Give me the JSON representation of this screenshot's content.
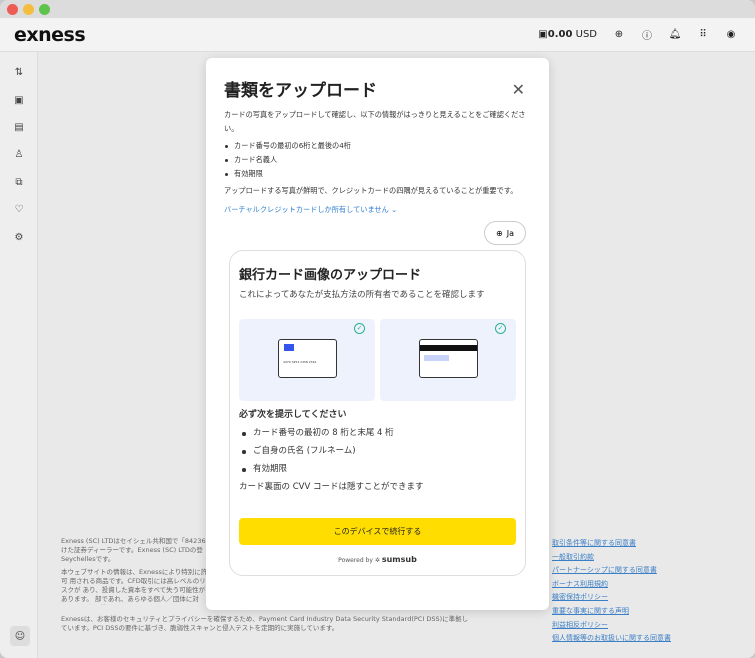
{
  "header": {
    "logo": "exness",
    "balance": "0.00",
    "currency": "USD"
  },
  "modal": {
    "title": "書類をアップロード",
    "intro": "カードの写真をアップロードして確認し、以下の情報がはっきりと見えることをご確認ください。",
    "items": [
      "カード番号の最初の6桁と最後の4桁",
      "カード名義人",
      "有効期限"
    ],
    "note": "アップロードする写真が鮮明で、クレジットカードの四隅が見えるていることが重要です。",
    "virtual_link": "バーチャルクレジットカードしか所有していません",
    "lang": "Ja",
    "sumsub": {
      "title": "銀行カード画像のアップロード",
      "subtitle": "これによってあなたが支払方法の所有者であることを確認します",
      "card_front_number": "4479 3453 2358 2342",
      "req_title": "必ず次を提示してください",
      "req_items": [
        "カード番号の最初の 8 桁と末尾 4 桁",
        "ご自身の氏名 (フルネーム)",
        "有効期限"
      ],
      "cvv_note": "カード裏面の CVV コードは隠すことができます",
      "continue": "このデバイスで続行する",
      "powered_by": "Powered by",
      "brand": "sumsub"
    }
  },
  "footer": {
    "p1": "Exness (SC) LTDはセイシェル共和国で「84236 けた証券ディーラーです。Exness (SC) LTDの登 Seychellesです。",
    "p2": "本ウェブサイトの情報は、Exnessにより特別に許可 用される商品です。CFD取引には高レベルのリスクが あり、投資した資本をすべて失う可能性があります。 部であれ、あらゆる個人／団体に対し、いかなる状",
    "p3": "Exnessは、お客様のセキュリティとプライバシーを確保するため、Payment Card Industry Data Security Standard(PCI DSS)に準拠しています。PCI DSSの要件に基づき、脆弱性スキャンと侵入テストを定期的に実施しています。",
    "links": [
      "取引条件等に関する同意書",
      "一般取引約款",
      "パートナーシップに関する同意書",
      "ボーナス利用規約",
      "機密保持ポリシー",
      "重要な事実に関する声明",
      "利益相反ポリシー",
      "個人情報等のお取扱いに関する同意書"
    ]
  },
  "colors": {
    "accent": "#ffdd00",
    "link": "#3b7fc6",
    "check": "#2bb38f"
  }
}
